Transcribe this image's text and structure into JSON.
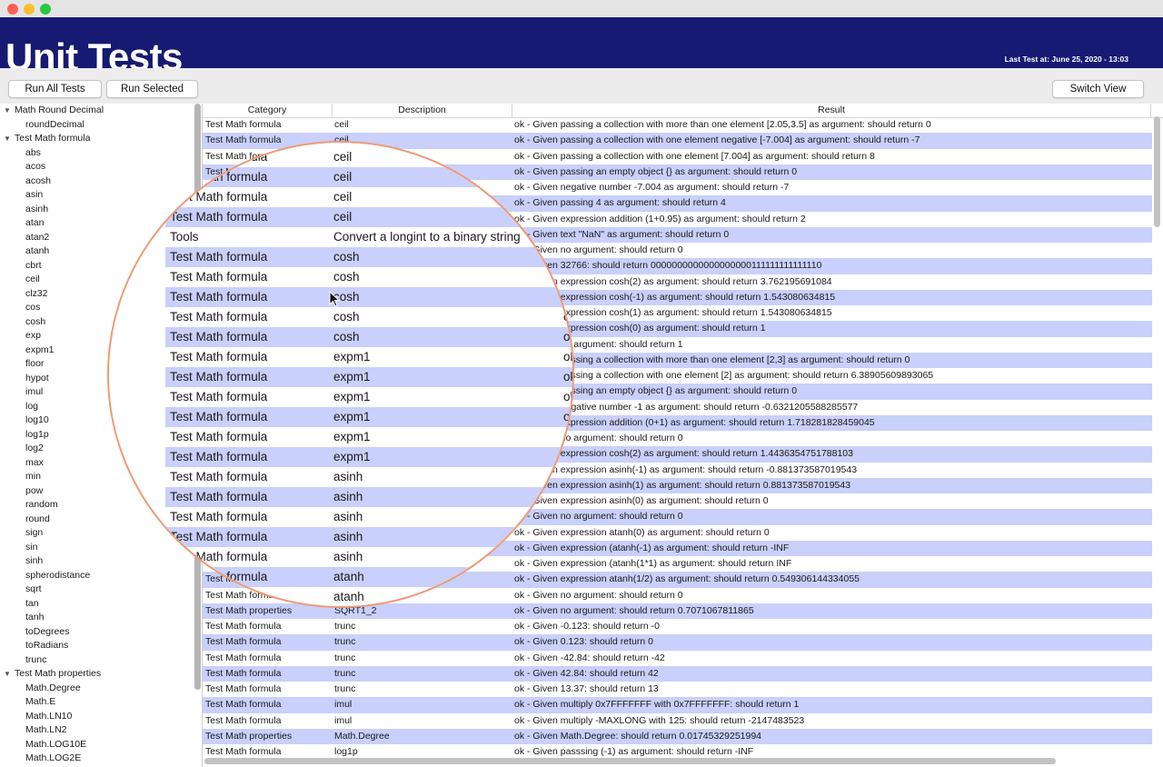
{
  "window": {
    "title": "Unit Tests",
    "last_test": "Last Test at: June 25, 2020 - 13:03"
  },
  "toolbar": {
    "run_all": "Run All Tests",
    "run_selected": "Run Selected",
    "switch_view": "Switch View"
  },
  "sidebar": {
    "groups": [
      {
        "label": "Math Round Decimal",
        "items": [
          "roundDecimal"
        ]
      },
      {
        "label": "Test Math formula",
        "items": [
          "abs",
          "acos",
          "acosh",
          "asin",
          "asinh",
          "atan",
          "atan2",
          "atanh",
          "cbrt",
          "ceil",
          "clz32",
          "cos",
          "cosh",
          "exp",
          "expm1",
          "floor",
          "hypot",
          "imul",
          "log",
          "log10",
          "log1p",
          "log2",
          "max",
          "min",
          "pow",
          "random",
          "round",
          "sign",
          "sin",
          "sinh",
          "spherodistance",
          "sqrt",
          "tan",
          "tanh",
          "toDegrees",
          "toRadians",
          "trunc"
        ]
      },
      {
        "label": "Test Math properties",
        "items": [
          "Math.Degree",
          "Math.E",
          "Math.LN10",
          "Math.LN2",
          "Math.LOG10E",
          "Math.LOG2E"
        ]
      }
    ]
  },
  "table": {
    "columns": [
      "Category",
      "Description",
      "Result"
    ],
    "rows": [
      [
        "Test Math formula",
        "ceil",
        "ok - Given passing a collection with more than one element [2.05,3.5] as argument: should return 0"
      ],
      [
        "Test Math formula",
        "ceil",
        "ok - Given passing a collection with one element negative [-7.004] as argument: should return -7"
      ],
      [
        "Test Math formula",
        "ceil",
        "ok - Given passing a collection with one element [7.004] as argument: should return 8"
      ],
      [
        "Test Math formula",
        "ceil",
        "ok - Given passing an empty object {} as argument: should return 0"
      ],
      [
        "Test Math formula",
        "ceil",
        "ok - Given negative number -7.004 as argument: should return -7"
      ],
      [
        "Test Math formula",
        "ceil",
        "ok - Given passing 4 as argument: should return 4"
      ],
      [
        "Test Math formula",
        "ceil",
        "ok - Given expression addition (1+0.95) as argument: should return 2"
      ],
      [
        "Tools",
        "Convert a longint to a binary string",
        "ok - Given text \"NaN\" as argument: should return 0"
      ],
      [
        "Test Math formula",
        "cosh",
        "ok - Given no argument: should return 0"
      ],
      [
        "Test Math formula",
        "cosh",
        "ok - Given 32766: should return 0000000000000000000111111111111110"
      ],
      [
        "Test Math formula",
        "cosh",
        "ok - Given expression cosh(2) as argument: should return 3.762195691084"
      ],
      [
        "Test Math formula",
        "cosh",
        "ok - Given expression cosh(-1) as argument: should return 1.543080634815"
      ],
      [
        "Test Math formula",
        "cosh",
        "ok - Given expression cosh(1) as argument: should return 1.543080634815"
      ],
      [
        "Test Math formula",
        "cosh",
        "ok - Given expression cosh(0) as argument: should return 1"
      ],
      [
        "Test Math formula",
        "cosh",
        "ok - Given no argument: should return 1"
      ],
      [
        "Test Math formula",
        "expm1",
        "ok - Given passing a collection with more than one element [2,3] as argument: should return 0"
      ],
      [
        "Test Math formula",
        "expm1",
        "ok - Given passing a collection with one element [2] as argument: should return 6.38905609893065"
      ],
      [
        "Test Math formula",
        "expm1",
        "ok - Given passing an empty object {} as argument: should return 0"
      ],
      [
        "Test Math formula",
        "expm1",
        "ok - Given negative number -1 as argument: should return -0.6321205588285577"
      ],
      [
        "Test Math formula",
        "expm1",
        "ok - Given expression addition (0+1) as argument: should return 1.718281828459045"
      ],
      [
        "Test Math formula",
        "expm1",
        "ok - Given no argument: should return 0"
      ],
      [
        "Test Math formula",
        "asinh",
        "ok - Given expression cosh(2) as argument: should return 1.4436354751788103"
      ],
      [
        "Test Math formula",
        "asinh",
        "ok - Given expression asinh(-1) as argument: should return -0.881373587019543"
      ],
      [
        "Test Math formula",
        "asinh",
        "ok - Given expression asinh(1) as argument: should return 0.881373587019543"
      ],
      [
        "Test Math formula",
        "asinh",
        "ok - Given expression asinh(0) as argument: should return 0"
      ],
      [
        "Test Math formula",
        "asinh",
        "ok - Given no argument: should return 0"
      ],
      [
        "Test Math formula",
        "atanh",
        "ok - Given expression atanh(0) as argument: should return 0"
      ],
      [
        "Test Math formula",
        "atanh",
        "ok - Given expression (atanh(-1) as argument: should return -INF"
      ],
      [
        "Test Math formula",
        "atanh",
        "ok - Given expression (atanh(1*1) as argument: should return INF"
      ],
      [
        "Test Math formula",
        "atanh",
        "ok - Given expression atanh(1/2) as argument: should return 0.549306144334055"
      ],
      [
        "Test Math formula",
        "atanh",
        "ok - Given no argument: should return 0"
      ],
      [
        "Test Math properties",
        "SQRT1_2",
        "ok - Given no argument: should return 0.7071067811865"
      ],
      [
        "Test Math formula",
        "trunc",
        "ok - Given -0.123: should return -0"
      ],
      [
        "Test Math formula",
        "trunc",
        "ok - Given 0.123: should return 0"
      ],
      [
        "Test Math formula",
        "trunc",
        "ok - Given -42.84: should return -42"
      ],
      [
        "Test Math formula",
        "trunc",
        "ok - Given 42.84: should return 42"
      ],
      [
        "Test Math formula",
        "trunc",
        "ok - Given 13.37: should return 13"
      ],
      [
        "Test Math formula",
        "imul",
        "ok - Given multiply 0x7FFFFFFF with 0x7FFFFFFF: should return 1"
      ],
      [
        "Test Math formula",
        "imul",
        "ok - Given multiply -MAXLONG with 125: should return -2147483523"
      ],
      [
        "Test Math properties",
        "Math.Degree",
        "ok - Given Math.Degree: should return 0.01745329251994"
      ],
      [
        "Test Math formula",
        "log1p",
        "ok - Given passsing (-1) as argument: should return -INF"
      ]
    ]
  },
  "magnifier": {
    "rows": [
      [
        "Test Math formula",
        "ceil",
        ""
      ],
      [
        "Test Math formula",
        "ceil",
        ""
      ],
      [
        "Test Math formula",
        "ceil",
        ""
      ],
      [
        "Test Math formula",
        "ceil",
        ""
      ],
      [
        "Tools",
        "Convert a longint to a binary string",
        ""
      ],
      [
        "Test Math formula",
        "cosh",
        ""
      ],
      [
        "Test Math formula",
        "cosh",
        ""
      ],
      [
        "Test Math formula",
        "cosh",
        ""
      ],
      [
        "Test Math formula",
        "cosh",
        "ok"
      ],
      [
        "Test Math formula",
        "cosh",
        "ok"
      ],
      [
        "Test Math formula",
        "expm1",
        "ok"
      ],
      [
        "Test Math formula",
        "expm1",
        "ok"
      ],
      [
        "Test Math formula",
        "expm1",
        "ok"
      ],
      [
        "Test Math formula",
        "expm1",
        "ok"
      ],
      [
        "Test Math formula",
        "expm1",
        "ok"
      ],
      [
        "Test Math formula",
        "expm1",
        ""
      ],
      [
        "Test Math formula",
        "asinh",
        ""
      ],
      [
        "Test Math formula",
        "asinh",
        ""
      ],
      [
        "Test Math formula",
        "asinh",
        ""
      ],
      [
        "Test Math formula",
        "asinh",
        ""
      ],
      [
        "Test Math formula",
        "asinh",
        ""
      ],
      [
        "Test Math formula",
        "atanh",
        ""
      ],
      [
        "Test Math formula",
        "atanh",
        ""
      ]
    ]
  },
  "colors": {
    "banner": "#171a72",
    "row_alt": "#c9d0fb",
    "magnifier_ring": "#ef9a77"
  }
}
